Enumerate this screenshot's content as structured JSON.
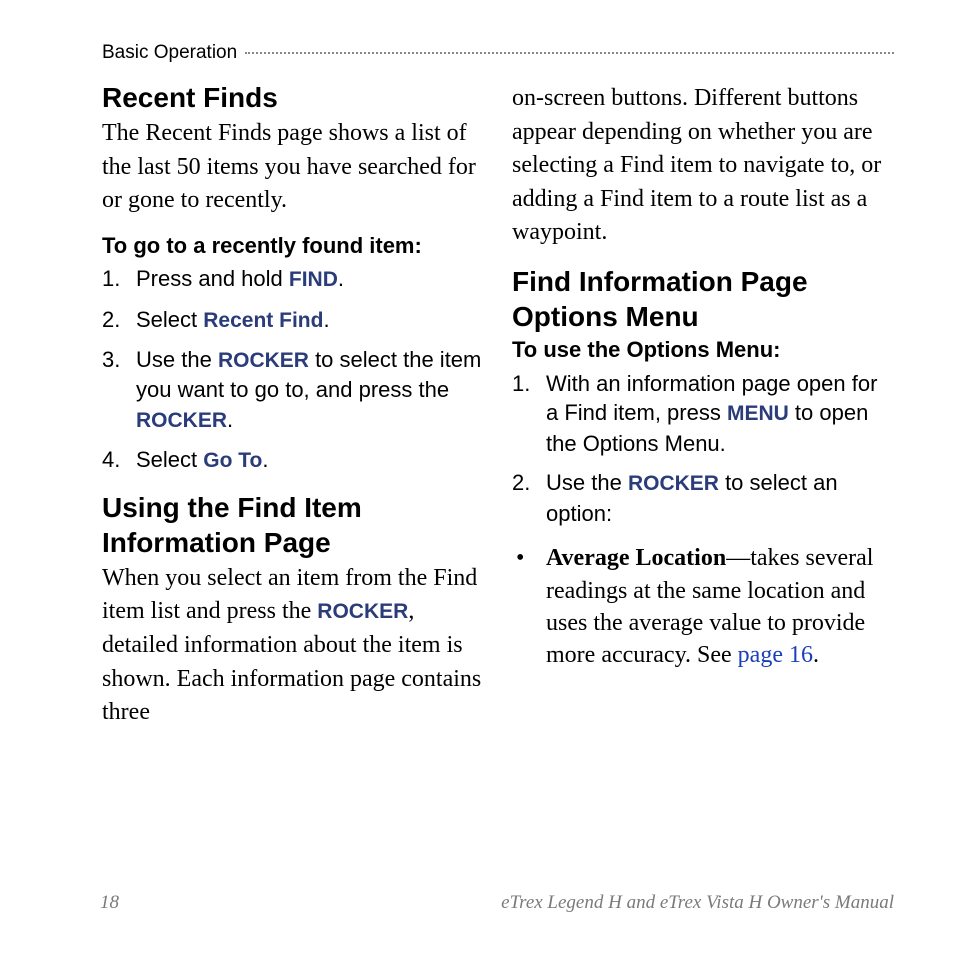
{
  "header": {
    "section": "Basic Operation"
  },
  "col1": {
    "h_recent": "Recent Finds",
    "p_recent": "The Recent Finds page shows a list of the last 50 items you have searched for or gone to recently.",
    "lead_goto": "To go to a recently found item:",
    "step1_a": "Press and hold ",
    "step1_kw": "FIND",
    "step1_b": ".",
    "step2_a": "Select ",
    "step2_kw": "Recent Find",
    "step2_b": ".",
    "step3_a": "Use the ",
    "step3_kw1": "ROCKER",
    "step3_b": " to select the item you want to go to, and press the ",
    "step3_kw2": "ROCKER",
    "step3_c": ".",
    "step4_a": "Select ",
    "step4_kw": "Go To",
    "step4_b": ".",
    "h_using": "Using the Find Item Information Page",
    "p_using_a": "When you select an item from the Find item list and press the ",
    "p_using_kw": "ROCKER",
    "p_using_b": ", detailed information about the item is shown. Each information page contains three"
  },
  "col2": {
    "p_cont": "on-screen buttons. Different buttons appear depending on whether you are selecting a Find item to navigate to, or adding a Find item to a route list as a waypoint.",
    "h_options": "Find Information Page Options Menu",
    "lead_options": "To use the Options Menu:",
    "ostep1_a": "With an information page open for a Find item, press ",
    "ostep1_kw": "MENU",
    "ostep1_b": " to open the Options Menu.",
    "ostep2_a": "Use the ",
    "ostep2_kw": "ROCKER",
    "ostep2_b": " to select an option:",
    "bul1_bold": "Average Location",
    "bul1_a": "—takes several readings at the same location and uses the average value to provide more accuracy. See ",
    "bul1_link": "page 16",
    "bul1_b": "."
  },
  "footer": {
    "page": "18",
    "title": "eTrex Legend H and eTrex Vista H Owner's Manual"
  }
}
